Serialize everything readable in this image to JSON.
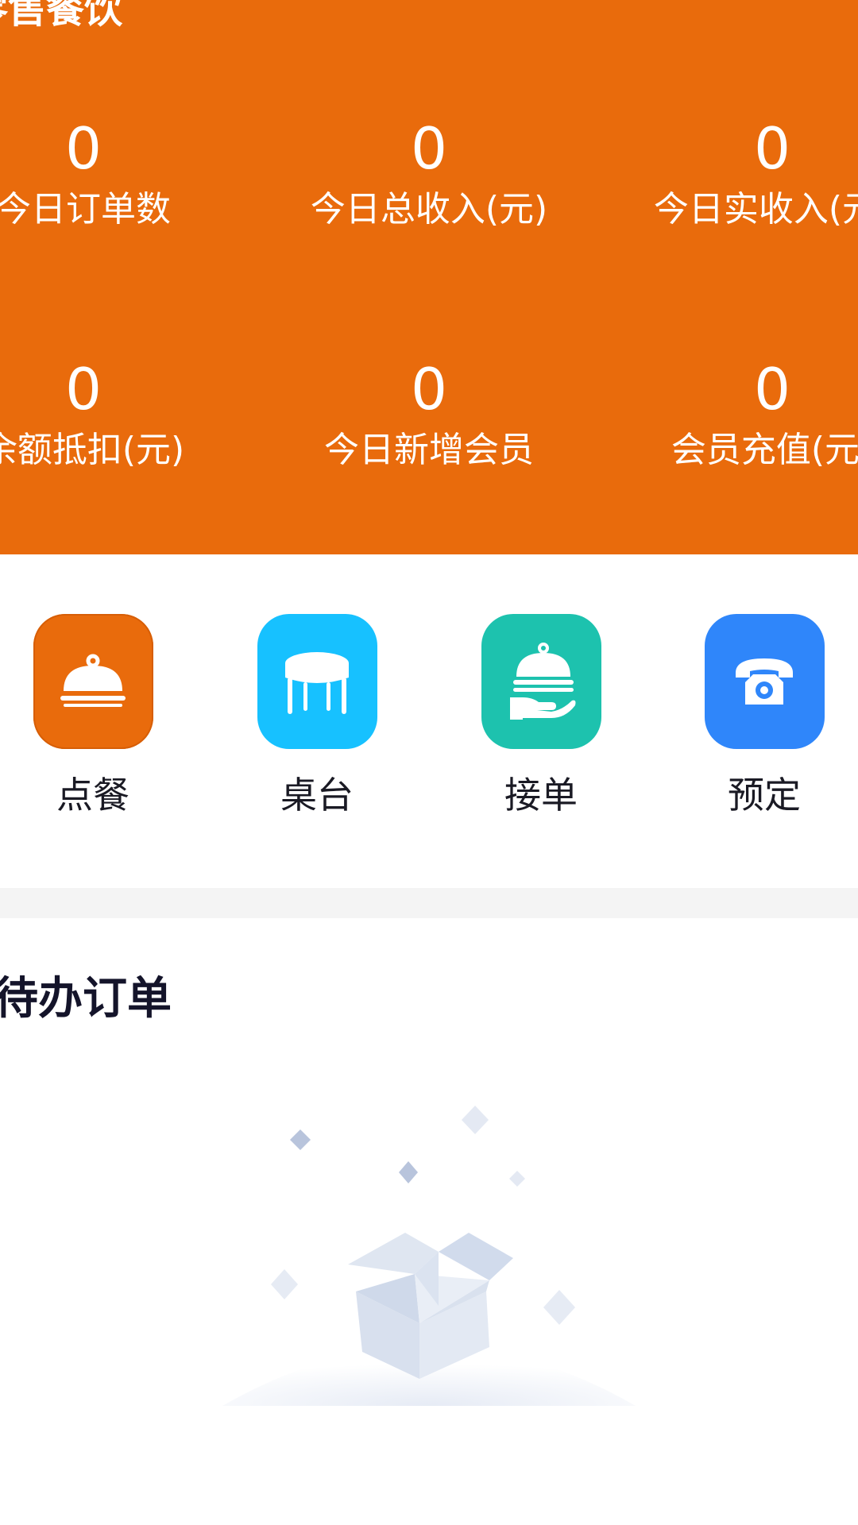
{
  "header": {
    "title": "零售餐饮",
    "stats": [
      {
        "value": "0",
        "label": "今日订单数"
      },
      {
        "value": "0",
        "label": "今日总收入(元)"
      },
      {
        "value": "0",
        "label": "今日实收入(元)"
      },
      {
        "value": "0",
        "label": "余额抵扣(元)"
      },
      {
        "value": "0",
        "label": "今日新增会员"
      },
      {
        "value": "0",
        "label": "会员充值(元)"
      }
    ]
  },
  "quick_actions": [
    {
      "label": "点餐",
      "icon": "dining-cloche-icon",
      "color": "#E96B0C"
    },
    {
      "label": "桌台",
      "icon": "table-icon",
      "color": "#17C1FF"
    },
    {
      "label": "接单",
      "icon": "serving-hand-icon",
      "color": "#1DC2AE"
    },
    {
      "label": "预定",
      "icon": "telephone-icon",
      "color": "#2F86FA"
    }
  ],
  "pending": {
    "title": "待办订单"
  },
  "colors": {
    "brand": "#E96B0C",
    "divider": "#f4f4f4"
  }
}
